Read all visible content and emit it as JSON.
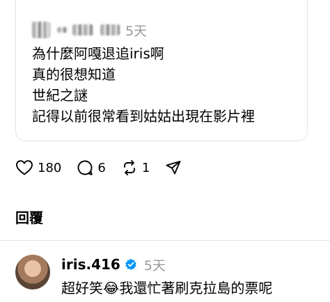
{
  "quoted_post": {
    "time": "5天",
    "lines": [
      "為什麼阿嘎退追iris啊",
      "真的很想知道",
      "世紀之謎",
      "記得以前很常看到姑姑出現在影片裡"
    ],
    "likes": "180",
    "comments": "6",
    "reposts": "1"
  },
  "replies": {
    "title": "回覆",
    "items": [
      {
        "username": "iris.416",
        "time": "5天",
        "text": "超好笑😂我還忙著刷克拉島的票呢"
      }
    ]
  },
  "icons": [
    "heart-icon",
    "comment-icon",
    "repost-icon",
    "share-icon",
    "verified-icon"
  ],
  "colors": {
    "muted_text": "#9a9a9a",
    "verified_badge": "#0095f6",
    "border": "#e4e4e4"
  }
}
